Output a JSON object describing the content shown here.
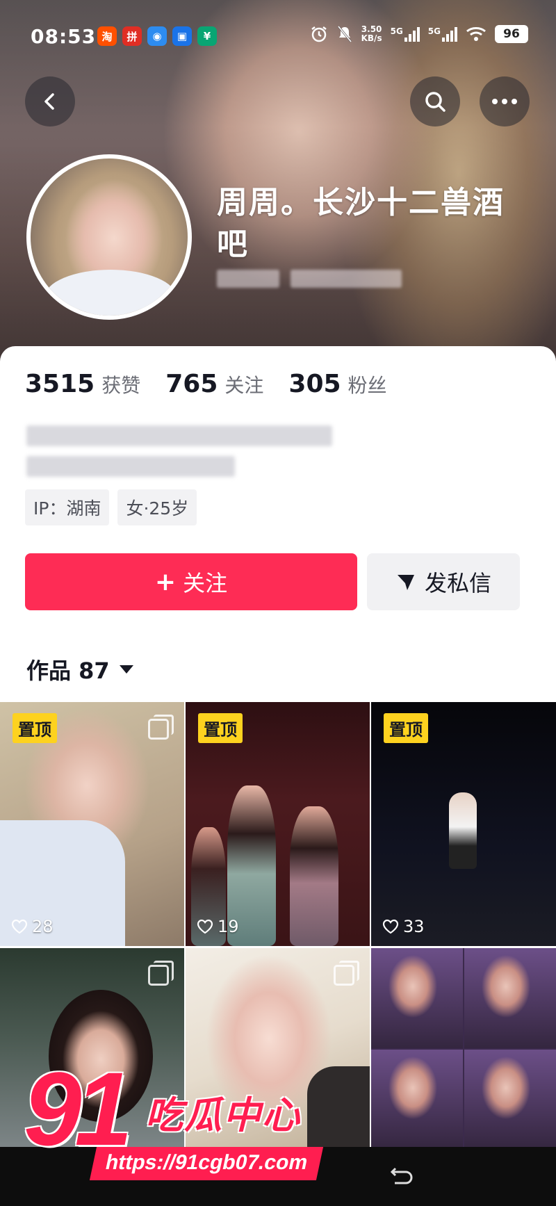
{
  "status_bar": {
    "time": "08:53",
    "apps": [
      {
        "name": "taobao-app-icon",
        "glyph": "淘",
        "color": "#ff5000"
      },
      {
        "name": "pdd-app-icon",
        "glyph": "拼",
        "color": "#e02e24"
      },
      {
        "name": "browser-app-icon",
        "glyph": "◉",
        "color": "#2d8cf0"
      },
      {
        "name": "message-app-icon",
        "glyph": "▣",
        "color": "#1a73e8"
      },
      {
        "name": "payment-app-icon",
        "glyph": "¥",
        "color": "#09a573"
      }
    ],
    "speed_value": "3.50",
    "speed_unit": "KB/s",
    "net1": "5G",
    "net2": "5G",
    "battery": "96"
  },
  "profile": {
    "display_name": "周周。长沙十二兽酒吧",
    "stats": [
      {
        "value": "3515",
        "label": "获赞"
      },
      {
        "value": "765",
        "label": "关注"
      },
      {
        "value": "305",
        "label": "粉丝"
      }
    ],
    "tags": [
      "IP：湖南",
      "女·25岁"
    ],
    "follow_label": "关注",
    "follow_plus": "+",
    "message_label": "发私信"
  },
  "works": {
    "tab_label": "作品",
    "count": "87",
    "pin_label": "置顶",
    "tiles": [
      {
        "pinned": true,
        "likes": "28",
        "multi": true
      },
      {
        "pinned": true,
        "likes": "19",
        "multi": false
      },
      {
        "pinned": true,
        "likes": "33",
        "multi": false
      },
      {
        "pinned": false,
        "likes": "",
        "multi": true
      },
      {
        "pinned": false,
        "likes": "",
        "multi": true
      },
      {
        "pinned": false,
        "likes": "",
        "multi": false
      }
    ]
  },
  "watermark": {
    "number": "91",
    "title": "吃瓜中心",
    "url": "https://91cgb07.com"
  },
  "colors": {
    "accent": "#fe2c55",
    "pin_badge": "#fdd21f",
    "watermark": "#ff1e50"
  }
}
